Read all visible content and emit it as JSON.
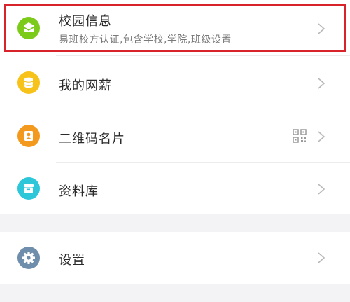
{
  "menu": {
    "campus_info": {
      "title": "校园信息",
      "subtitle": "易班校方认证,包含学校,学院,班级设置",
      "icon": "envelope-icon",
      "color": "#7ccb1b"
    },
    "salary": {
      "title": "我的网薪",
      "icon": "coins-icon",
      "color": "#f7c21a"
    },
    "qr_card": {
      "title": "二维码名片",
      "icon": "contact-card-icon",
      "color": "#f39a1e"
    },
    "library": {
      "title": "资料库",
      "icon": "box-icon",
      "color": "#2ec6d9"
    },
    "settings": {
      "title": "设置",
      "icon": "gear-icon",
      "color": "#6f8eab"
    }
  },
  "highlight_color": "#d8232a"
}
